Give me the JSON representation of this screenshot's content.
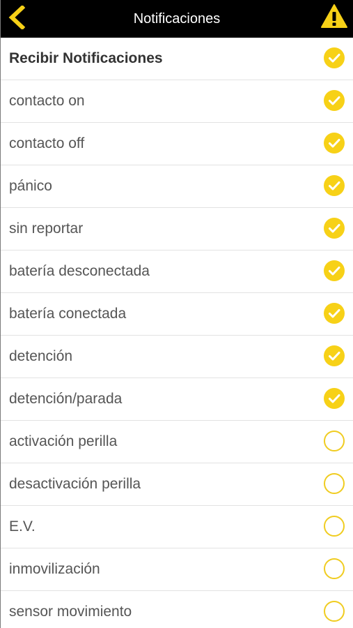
{
  "header": {
    "title": "Notificaciones",
    "back_icon": "chevron-left-icon",
    "warning_icon": "warning-triangle-icon"
  },
  "colors": {
    "accent": "#f7d117",
    "header_bg": "#000000",
    "text": "#555555"
  },
  "items": [
    {
      "label": "Recibir Notificaciones",
      "checked": true
    },
    {
      "label": "contacto on",
      "checked": true
    },
    {
      "label": "contacto off",
      "checked": true
    },
    {
      "label": "pánico",
      "checked": true
    },
    {
      "label": "sin reportar",
      "checked": true
    },
    {
      "label": "batería desconectada",
      "checked": true
    },
    {
      "label": "batería conectada",
      "checked": true
    },
    {
      "label": "detención",
      "checked": true
    },
    {
      "label": "detención/parada",
      "checked": true
    },
    {
      "label": "activación perilla",
      "checked": false
    },
    {
      "label": "desactivación perilla",
      "checked": false
    },
    {
      "label": "E.V.",
      "checked": false
    },
    {
      "label": "inmovilización",
      "checked": false
    },
    {
      "label": "sensor movimiento",
      "checked": false
    }
  ]
}
